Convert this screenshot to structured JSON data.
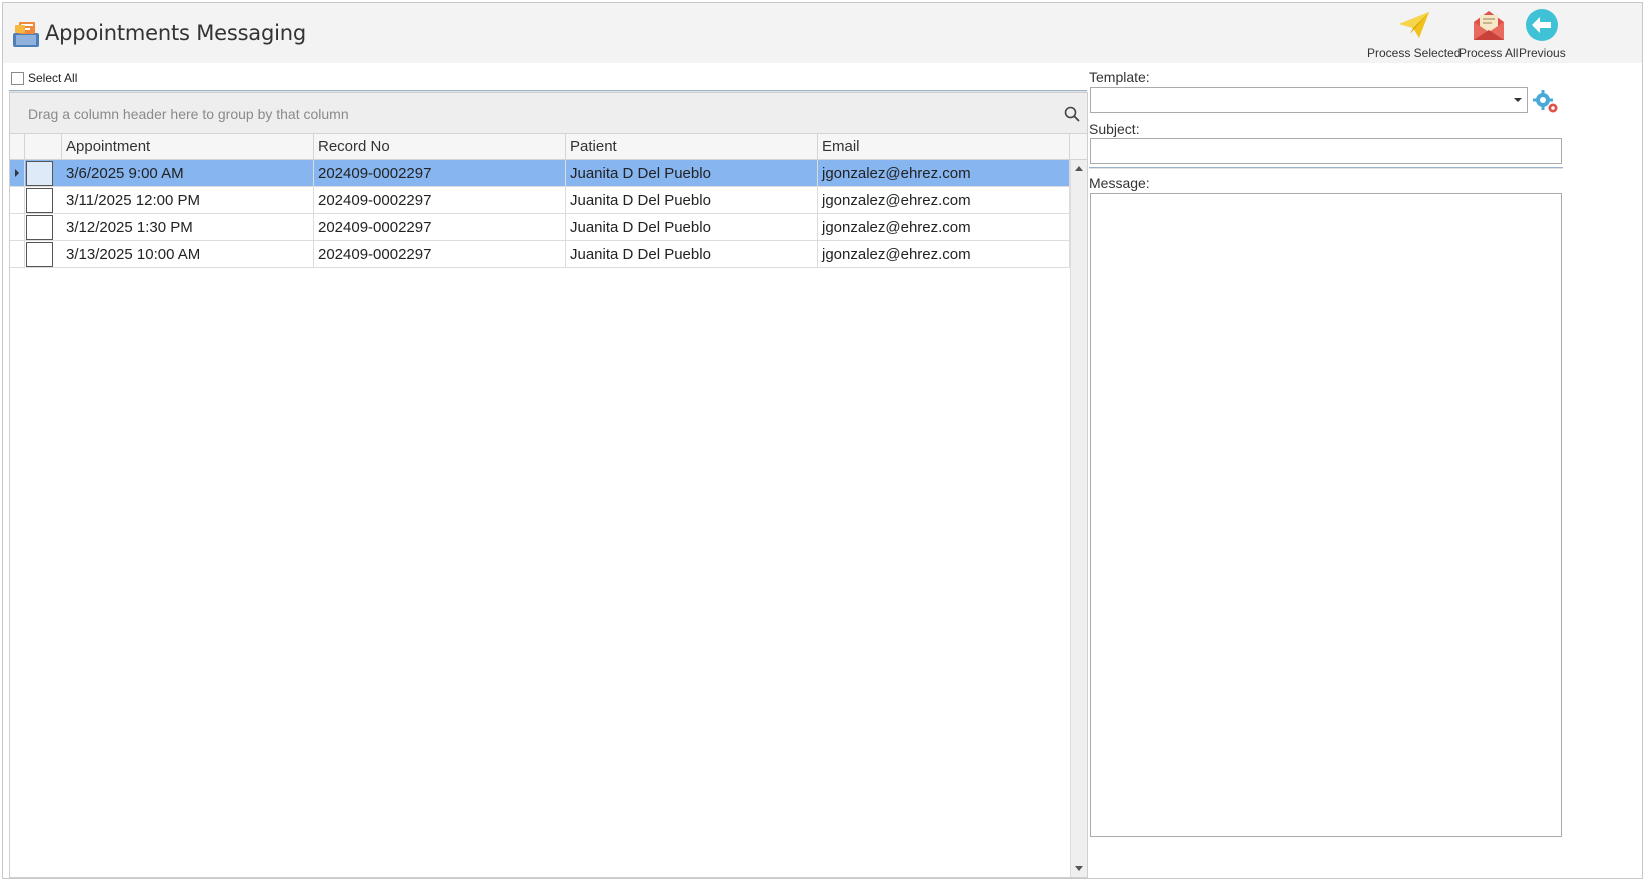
{
  "header": {
    "title": "Appointments Messaging",
    "buttons": {
      "process_selected": "Process Selected",
      "process_all": "Process All",
      "previous": "Previous"
    }
  },
  "select_all_label": "Select All",
  "grid": {
    "group_panel_hint": "Drag a column header here to group by that column",
    "columns": [
      "Appointment",
      "Record No",
      "Patient",
      "Email"
    ],
    "rows": [
      {
        "appointment": "3/6/2025 9:00 AM",
        "record_no": "202409-0002297",
        "patient": "Juanita D Del Pueblo",
        "email": "jgonzalez@ehrez.com",
        "selected": true
      },
      {
        "appointment": "3/11/2025 12:00 PM",
        "record_no": "202409-0002297",
        "patient": "Juanita D Del Pueblo",
        "email": "jgonzalez@ehrez.com",
        "selected": false
      },
      {
        "appointment": "3/12/2025 1:30 PM",
        "record_no": "202409-0002297",
        "patient": "Juanita D Del Pueblo",
        "email": "jgonzalez@ehrez.com",
        "selected": false
      },
      {
        "appointment": "3/13/2025 10:00 AM",
        "record_no": "202409-0002297",
        "patient": "Juanita D Del Pueblo",
        "email": "jgonzalez@ehrez.com",
        "selected": false
      }
    ]
  },
  "form": {
    "template_label": "Template:",
    "template_value": "",
    "subject_label": "Subject:",
    "subject_value": "",
    "message_label": "Message:",
    "message_value": ""
  },
  "colors": {
    "selected_row": "#86b5ef",
    "header_bg": "#f3f3f3",
    "previous_icon": "#3fc1d6",
    "envelope": "#e0514a",
    "paper_plane": "#f2c21a"
  },
  "icons": {
    "app": "app-messaging-icon",
    "process_selected": "paper-plane-icon",
    "process_all": "envelope-open-icon",
    "previous": "arrow-left-circle-icon",
    "search": "search-icon",
    "template_settings": "gears-icon"
  }
}
